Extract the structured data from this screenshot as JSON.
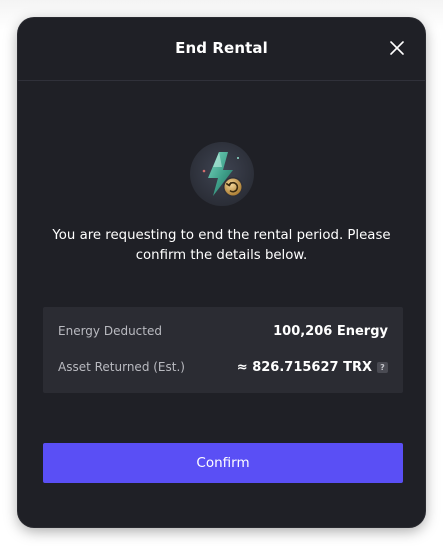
{
  "modal": {
    "title": "End Rental",
    "message": "You are requesting to end the rental period. Please confirm the details below.",
    "details": [
      {
        "label": "Energy Deducted",
        "value": "100,206 Energy"
      },
      {
        "label": "Asset Returned (Est.)",
        "value": "≈ 826.715627 TRX"
      }
    ],
    "help_glyph": "?",
    "confirm_label": "Confirm"
  },
  "icons": {
    "close": "close-icon",
    "hero": "energy-return-icon",
    "help": "help-icon"
  },
  "colors": {
    "modal_bg": "#1f2026",
    "details_bg": "#2b2c33",
    "accent": "#5a4ff5",
    "text": "#ffffff",
    "muted_text": "#b9bac0"
  }
}
